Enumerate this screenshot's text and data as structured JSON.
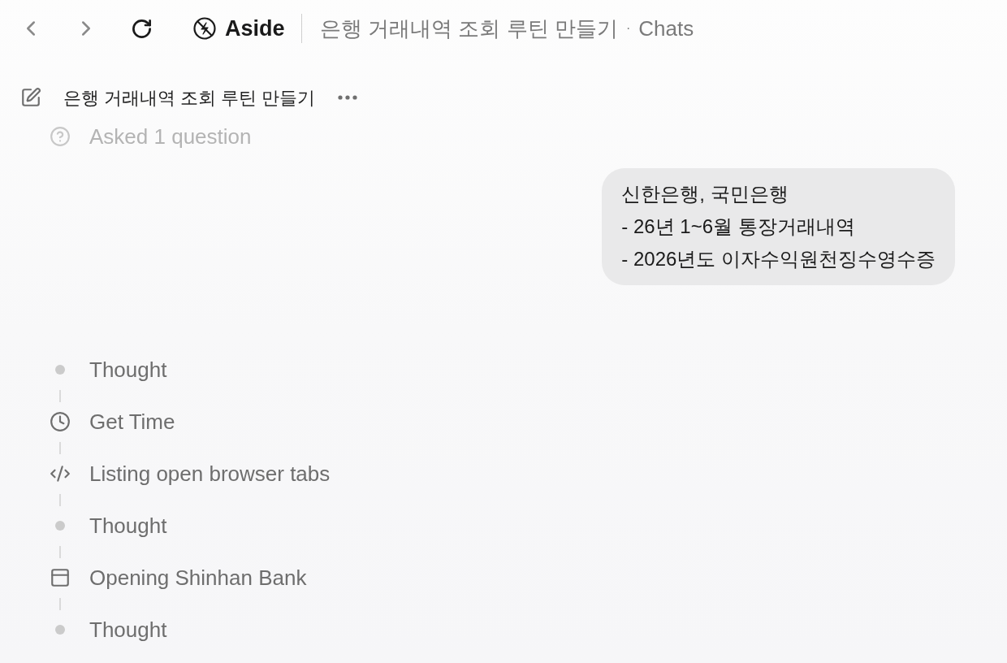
{
  "toolbar": {
    "app_name": "Aside",
    "breadcrumb": {
      "page": "은행 거래내역 조회 루틴 만들기",
      "separator": "·",
      "section": "Chats"
    }
  },
  "chat_header": {
    "title": "은행 거래내역 조회 루틴 만들기"
  },
  "collapsed_step": {
    "label": "Asked 1 question"
  },
  "user_message": {
    "lines": [
      "신한은행, 국민은행",
      "- 26년 1~6월 통장거래내역",
      "- 2026년도 이자수익원천징수영수증"
    ]
  },
  "steps": [
    {
      "kind": "thought",
      "label": "Thought"
    },
    {
      "kind": "clock",
      "label": "Get Time"
    },
    {
      "kind": "code",
      "label": "Listing open browser tabs"
    },
    {
      "kind": "thought",
      "label": "Thought"
    },
    {
      "kind": "window",
      "label": "Opening Shinhan Bank"
    },
    {
      "kind": "thought",
      "label": "Thought"
    }
  ]
}
